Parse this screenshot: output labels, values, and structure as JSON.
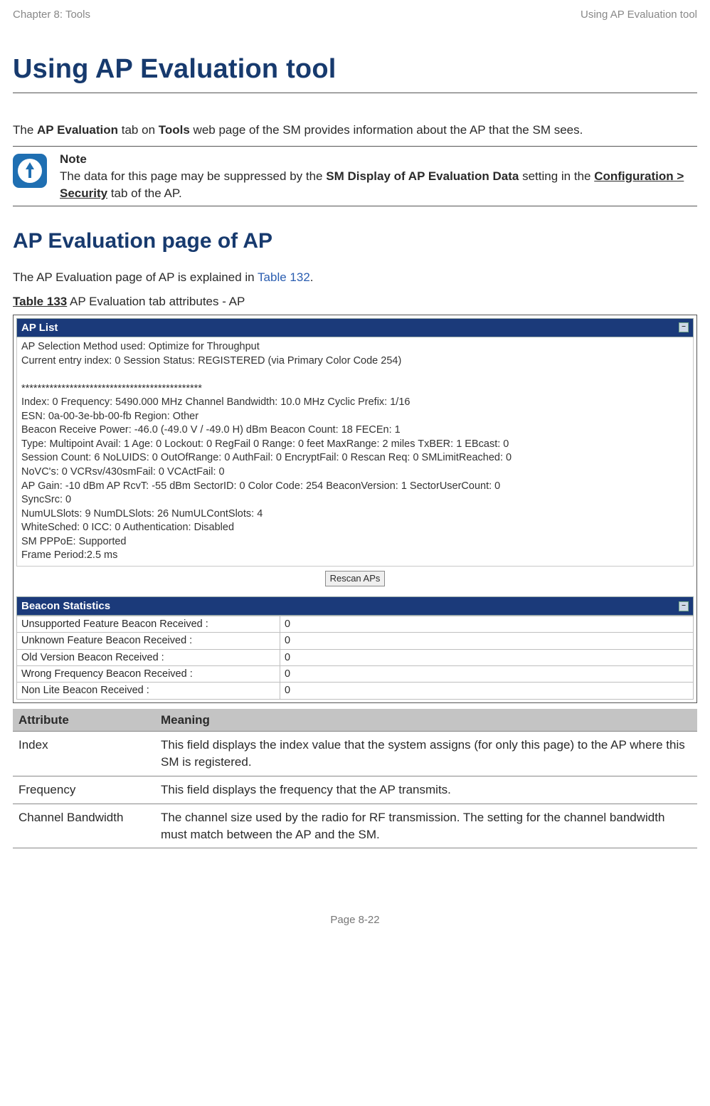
{
  "header": {
    "left": "Chapter 8:  Tools",
    "right": "Using AP Evaluation tool"
  },
  "title": "Using AP Evaluation tool",
  "intro": {
    "pre": "The ",
    "b1": "AP Evaluation",
    "mid1": " tab on ",
    "b2": "Tools",
    "rest": " web page of the SM provides information about the AP that the SM sees."
  },
  "note": {
    "title": "Note",
    "l1a": "The data for this page may be suppressed by the ",
    "l1b": "SM Display of AP Evaluation Data",
    "l2a": "setting in the ",
    "l2b": "Configuration > Security",
    "l2c": " tab of the AP."
  },
  "section2": "AP Evaluation page of AP",
  "sec2_para": {
    "a": "The AP Evaluation page of AP is explained in ",
    "link": "Table 132",
    "b": "."
  },
  "caption": {
    "b": "Table 133",
    "rest": "  AP Evaluation tab attributes - AP"
  },
  "ap_panel": {
    "title": "AP List",
    "lines": [
      "AP Selection Method used: Optimize for Throughput",
      "Current entry index: 0 Session Status: REGISTERED (via Primary Color Code 254)",
      "",
      "*********************************************",
      "Index: 0 Frequency: 5490.000 MHz  Channel Bandwidth: 10.0 MHz  Cyclic Prefix: 1/16",
      "ESN: 0a-00-3e-bb-00-fb Region: Other",
      "Beacon Receive Power: -46.0 (-49.0 V / -49.0 H) dBm Beacon Count: 18 FECEn: 1",
      "Type: Multipoint Avail: 1 Age: 0 Lockout: 0 RegFail 0 Range: 0 feet MaxRange: 2 miles TxBER: 1 EBcast: 0",
      "Session Count: 6 NoLUIDS: 0 OutOfRange: 0 AuthFail: 0 EncryptFail: 0 Rescan Req: 0 SMLimitReached: 0",
      "NoVC's: 0 VCRsv/430smFail: 0 VCActFail: 0",
      "AP Gain: -10 dBm AP RcvT: -55 dBm SectorID: 0 Color Code: 254 BeaconVersion: 1 SectorUserCount: 0",
      "SyncSrc: 0",
      "NumULSlots: 9 NumDLSlots: 26 NumULContSlots: 4",
      "WhiteSched: 0 ICC: 0 Authentication: Disabled",
      "SM PPPoE: Supported",
      "Frame Period:2.5 ms"
    ],
    "rescan": "Rescan APs"
  },
  "beacon_panel": {
    "title": "Beacon Statistics",
    "rows": [
      {
        "label": "Unsupported Feature Beacon Received :",
        "val": "0"
      },
      {
        "label": "Unknown Feature Beacon Received :",
        "val": "0"
      },
      {
        "label": "Old Version Beacon Received :",
        "val": "0"
      },
      {
        "label": "Wrong Frequency Beacon Received :",
        "val": "0"
      },
      {
        "label": "Non Lite Beacon Received :",
        "val": "0"
      }
    ]
  },
  "attrs": {
    "h1": "Attribute",
    "h2": "Meaning",
    "rows": [
      {
        "a": "Index",
        "m": "This field displays the index value that the system assigns (for only this page) to the AP where this SM is registered."
      },
      {
        "a": "Frequency",
        "m": "This field displays the frequency that the AP transmits."
      },
      {
        "a": "Channel Bandwidth",
        "m": "The channel size used by the radio for RF transmission. The setting for the channel bandwidth must match between the AP and the SM."
      }
    ]
  },
  "footer": "Page 8-22"
}
